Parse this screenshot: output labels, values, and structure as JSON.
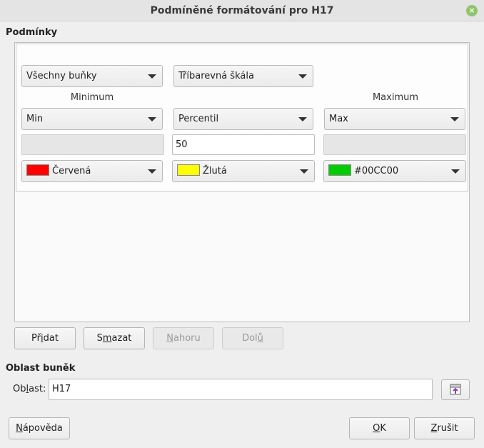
{
  "window": {
    "title": "Podmíněné formátování pro H17",
    "close_symbol": "×"
  },
  "conditions": {
    "section_title": "Podmínky",
    "entry": {
      "applies_to": "Všechny buňky",
      "type": "Tříbarevná škála",
      "min_label": "Minimum",
      "max_label": "Maximum",
      "min_type": "Min",
      "mid_type": "Percentil",
      "max_type": "Max",
      "min_value": "",
      "mid_value": "50",
      "max_value": "",
      "min_color": {
        "name": "Červená",
        "hex": "#ff0000"
      },
      "mid_color": {
        "name": "Žlutá",
        "hex": "#ffff00"
      },
      "max_color": {
        "name": "#00CC00",
        "hex": "#00cc00"
      }
    }
  },
  "buttons": {
    "add": {
      "pre": "Př",
      "key": "i",
      "post": "dat"
    },
    "delete": {
      "pre": "S",
      "key": "m",
      "post": "azat"
    },
    "up": {
      "pre": "",
      "key": "N",
      "post": "ahoru"
    },
    "down": {
      "pre": "Dol",
      "key": "ů",
      "post": ""
    }
  },
  "cell_range": {
    "section_title": "Oblast buněk",
    "label_pre": "Ob",
    "label_key": "l",
    "label_post": "ast:",
    "value": "H17",
    "shrink_icon": "shrink-range-icon"
  },
  "footer": {
    "help": {
      "pre": "",
      "key": "N",
      "post": "ápověda"
    },
    "ok": {
      "pre": "",
      "key": "O",
      "post": "K"
    },
    "cancel": {
      "pre": "",
      "key": "Z",
      "post": "rušit"
    }
  }
}
